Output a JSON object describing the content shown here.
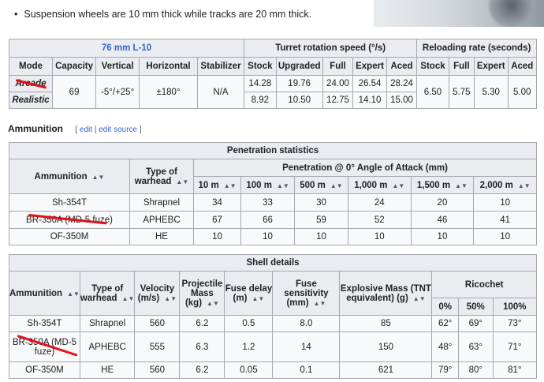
{
  "intro": {
    "bullet": "Suspension wheels are 10 mm thick while tracks are 20 mm thick."
  },
  "gun_table": {
    "gun_name": "76 mm L-10",
    "turret_header": "Turret rotation speed (°/s)",
    "reload_header": "Reloading rate (seconds)",
    "cols": [
      "Mode",
      "Capacity",
      "Vertical",
      "Horizontal",
      "Stabilizer",
      "Stock",
      "Upgraded",
      "Full",
      "Expert",
      "Aced",
      "Stock",
      "Full",
      "Expert",
      "Aced"
    ],
    "arcade": {
      "mode": "Arcade",
      "turret": [
        "14.28",
        "19.76",
        "24.00",
        "26.54",
        "28.24"
      ]
    },
    "realistic": {
      "mode": "Realistic",
      "turret": [
        "8.92",
        "10.50",
        "12.75",
        "14.10",
        "15.00"
      ]
    },
    "shared": {
      "capacity": "69",
      "vertical": "-5°/+25°",
      "horizontal": "±180°",
      "stabilizer": "N/A"
    },
    "reload": [
      "6.50",
      "5.75",
      "5.30",
      "5.00"
    ]
  },
  "ammo_heading": {
    "title": "Ammunition",
    "edit": "edit",
    "sep": "|",
    "edit_source": "edit source",
    "open": "[",
    "close": "]"
  },
  "pen_table": {
    "title": "Penetration statistics",
    "h_ammo": "Ammunition",
    "h_type": "Type of warhead",
    "h_pen": "Penetration @ 0° Angle of Attack (mm)",
    "distances": [
      "10 m",
      "100 m",
      "500 m",
      "1,000 m",
      "1,500 m",
      "2,000 m"
    ],
    "rows": [
      {
        "name": "Sh-354T",
        "type": "Shrapnel",
        "vals": [
          "34",
          "33",
          "30",
          "24",
          "20",
          "10"
        ]
      },
      {
        "name": "BR-350A (MD-5 fuze)",
        "type": "APHEBC",
        "vals": [
          "67",
          "66",
          "59",
          "52",
          "46",
          "41"
        ]
      },
      {
        "name": "OF-350M",
        "type": "HE",
        "vals": [
          "10",
          "10",
          "10",
          "10",
          "10",
          "10"
        ]
      }
    ]
  },
  "shell_table": {
    "title": "Shell details",
    "h": [
      "Ammunition",
      "Type of warhead",
      "Velocity (m/s)",
      "Projectile Mass (kg)",
      "Fuse delay (m)",
      "Fuse sensitivity (mm)",
      "Explosive Mass (TNT equivalent) (g)",
      "Ricochet"
    ],
    "ric": [
      "0%",
      "50%",
      "100%"
    ],
    "rows": [
      {
        "name": "Sh-354T",
        "type": "Shrapnel",
        "vel": "560",
        "mass": "6.2",
        "delay": "0.5",
        "sens": "8.0",
        "exp": "85",
        "ric": [
          "62°",
          "69°",
          "73°"
        ]
      },
      {
        "name": "BR-350A (MD-5 fuze)",
        "type": "APHEBC",
        "vel": "555",
        "mass": "6.3",
        "delay": "1.2",
        "sens": "14",
        "exp": "150",
        "ric": [
          "48°",
          "63°",
          "71°"
        ]
      },
      {
        "name": "OF-350M",
        "type": "HE",
        "vel": "560",
        "mass": "6.2",
        "delay": "0.05",
        "sens": "0.1",
        "exp": "621",
        "ric": [
          "79°",
          "80°",
          "81°"
        ]
      }
    ]
  },
  "icons": {
    "sort": "sort-arrows-icon"
  }
}
